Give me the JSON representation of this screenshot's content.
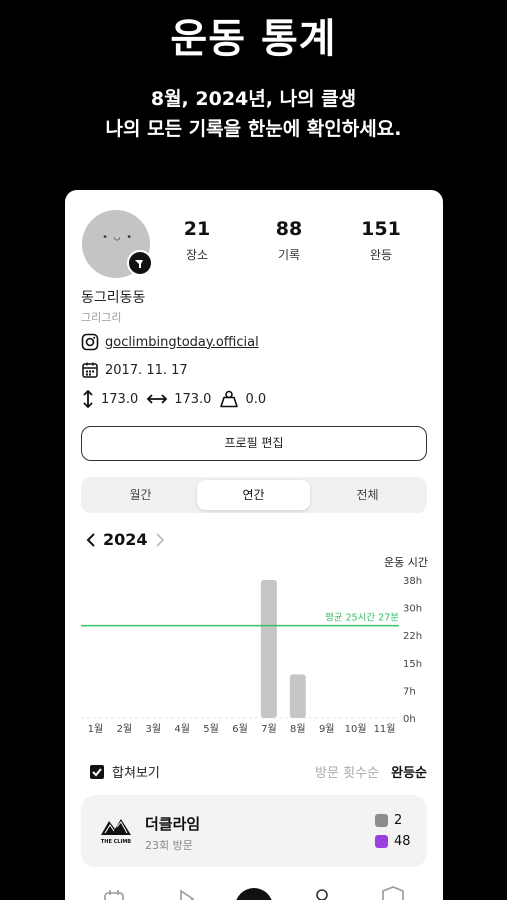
{
  "hero": {
    "title": "운동 통계",
    "line1": "8월, 2024년, 나의 클생",
    "line2": "나의 모든 기록을 한눈에 확인하세요."
  },
  "profile": {
    "avatar_face": "• ◡ •",
    "stats": [
      {
        "value": "21",
        "label": "장소"
      },
      {
        "value": "88",
        "label": "기록"
      },
      {
        "value": "151",
        "label": "완등"
      }
    ],
    "name": "동그리동동",
    "subname": "그리그리",
    "instagram": "goclimbingtoday.official",
    "date": "2017. 11. 17",
    "height": "173.0",
    "reach": "173.0",
    "weight": "0.0",
    "edit_label": "프로필 편집"
  },
  "tabs": [
    "월간",
    "연간",
    "전체"
  ],
  "active_tab": 1,
  "year_nav": {
    "year": "2024"
  },
  "chart_data": {
    "type": "bar",
    "title": "운동 시간",
    "categories": [
      "1월",
      "2월",
      "3월",
      "4월",
      "5월",
      "6월",
      "7월",
      "8월",
      "9월",
      "10월",
      "11월"
    ],
    "values": [
      0,
      0,
      0,
      0,
      0,
      0,
      38,
      12,
      0,
      0,
      0
    ],
    "y_ticks": [
      "0h",
      "7h",
      "15h",
      "22h",
      "30h",
      "38h"
    ],
    "ylim": [
      0,
      38
    ],
    "average": {
      "value": 25.45,
      "label": "평균 25시간 27분",
      "color": "#3bbf6a"
    },
    "bar_color": "#c6c6c6"
  },
  "filter": {
    "merge_label": "합쳐보기",
    "sort_visits": "방문 횟수순",
    "sort_sends": "완등순"
  },
  "gym": {
    "name": "더클라임",
    "visits": "23회 방문",
    "logo_text": "THE CLIMB",
    "stat1": "2",
    "stat1_color": "#8c8c8c",
    "stat2": "48",
    "stat2_color": "#9b3fe0"
  },
  "icons": [
    "instagram-icon",
    "calendar-icon",
    "height-icon",
    "reach-icon",
    "weight-icon",
    "chevron-left-icon",
    "chevron-right-icon",
    "check-icon"
  ]
}
